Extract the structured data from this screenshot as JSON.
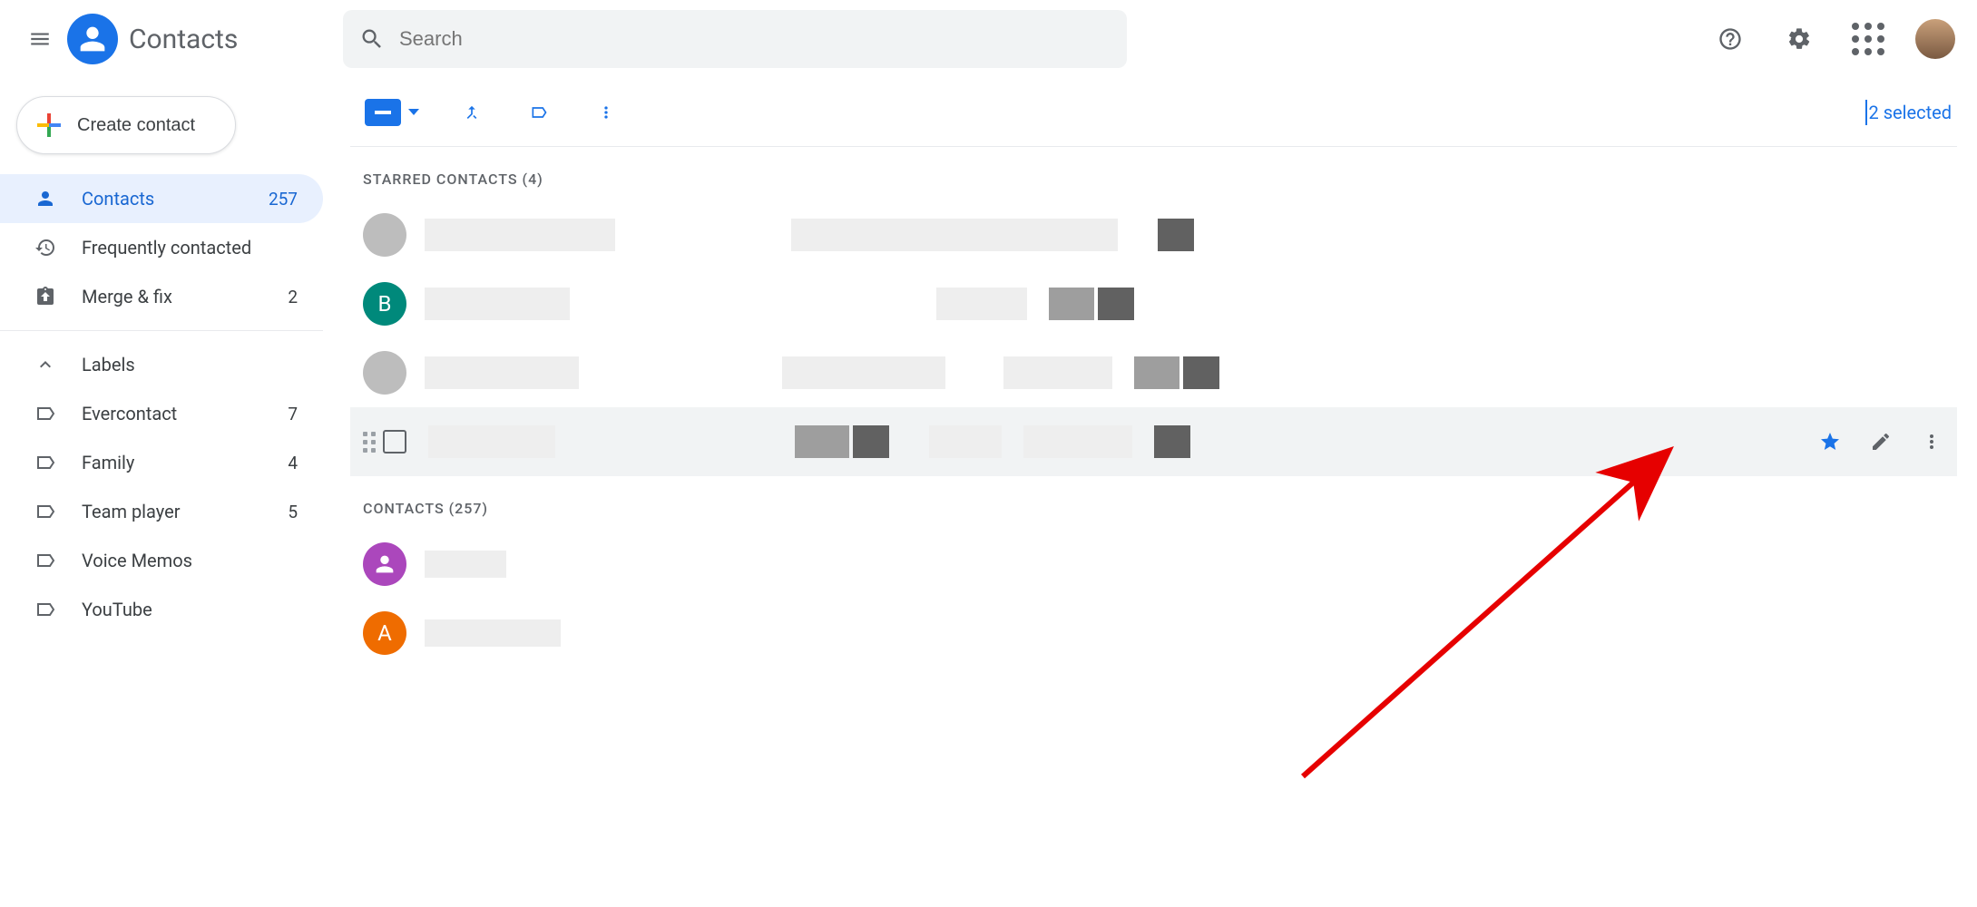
{
  "header": {
    "app_title": "Contacts",
    "search_placeholder": "Search"
  },
  "sidebar": {
    "create_label": "Create contact",
    "items": [
      {
        "label": "Contacts",
        "count": "257",
        "icon": "person"
      },
      {
        "label": "Frequently contacted",
        "count": "",
        "icon": "history"
      },
      {
        "label": "Merge & fix",
        "count": "2",
        "icon": "merge-fix"
      }
    ],
    "labels_header": "Labels",
    "labels": [
      {
        "label": "Evercontact",
        "count": "7"
      },
      {
        "label": "Family",
        "count": "4"
      },
      {
        "label": "Team player",
        "count": "5"
      },
      {
        "label": "Voice Memos",
        "count": ""
      },
      {
        "label": "YouTube",
        "count": ""
      }
    ]
  },
  "toolbar": {
    "selected_text": "2 selected"
  },
  "sections": {
    "starred_title": "STARRED CONTACTS (4)",
    "contacts_title": "CONTACTS (257)"
  },
  "starred_rows": [
    {
      "avatar_type": "pix",
      "letter": ""
    },
    {
      "avatar_type": "letter",
      "letter": "B"
    },
    {
      "avatar_type": "pix",
      "letter": ""
    },
    {
      "avatar_type": "checkbox",
      "letter": ""
    }
  ],
  "contact_rows": [
    {
      "avatar_type": "purple",
      "letter": ""
    },
    {
      "avatar_type": "letter-a",
      "letter": "A"
    }
  ]
}
